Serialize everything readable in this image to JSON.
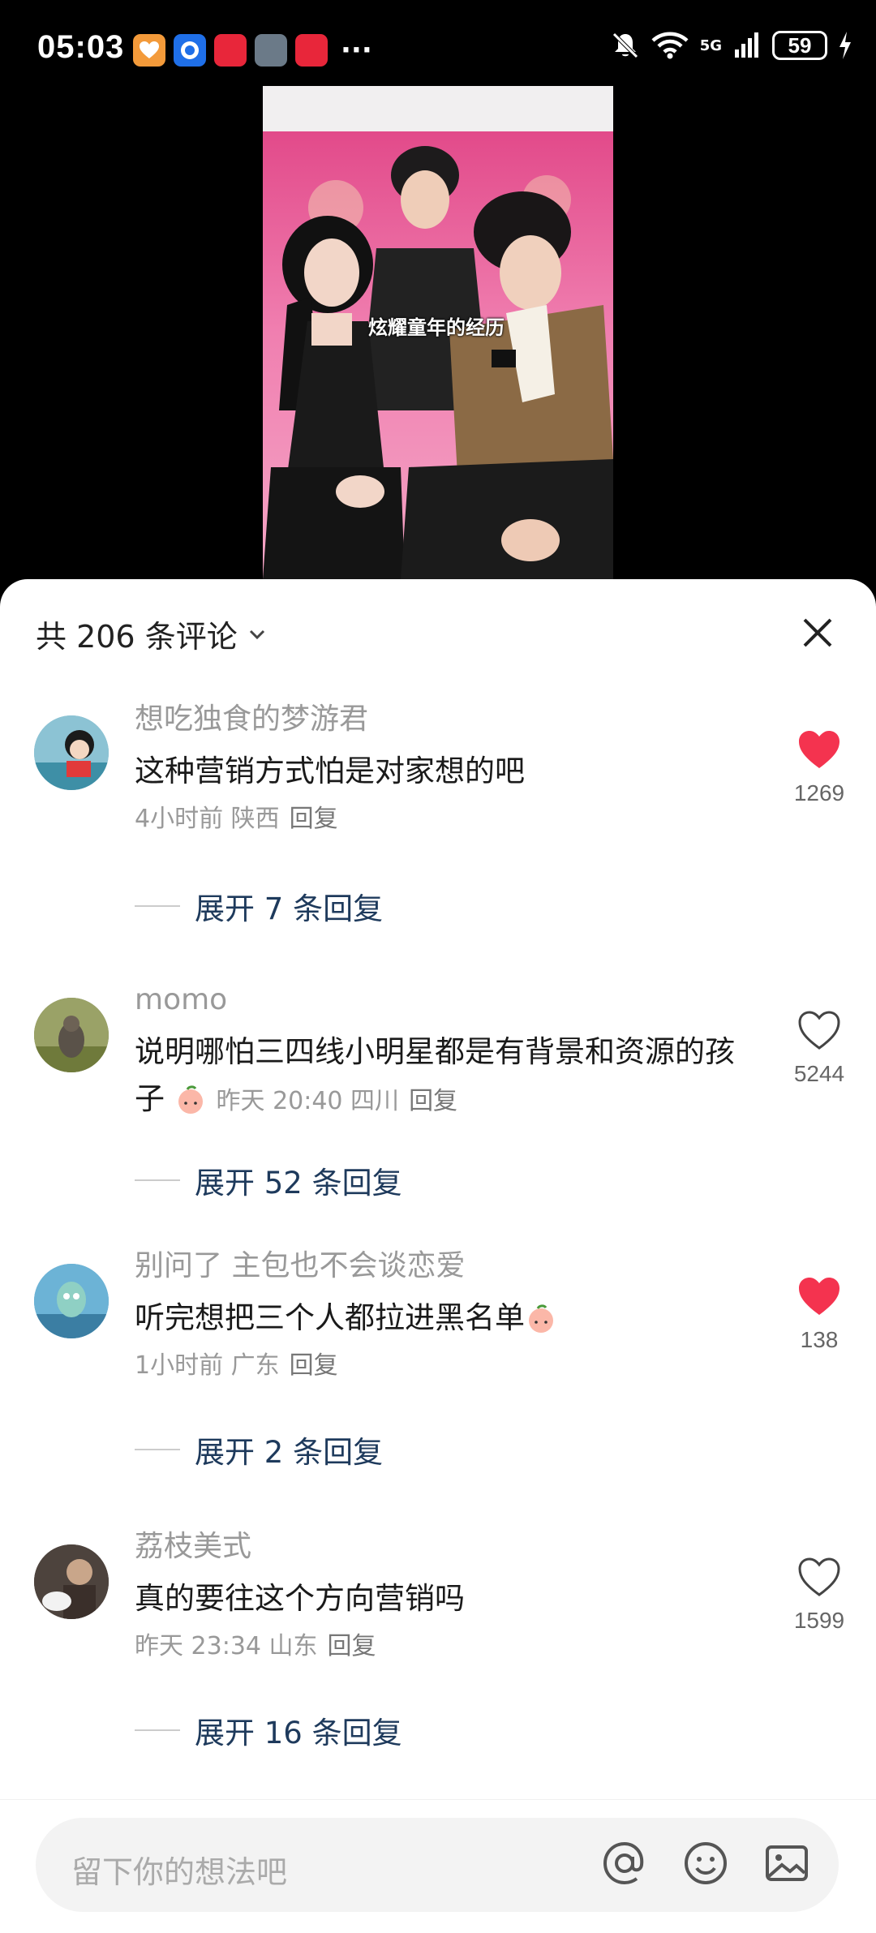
{
  "status_bar": {
    "time": "05:03",
    "battery": "59",
    "network": "5G"
  },
  "video": {
    "caption": "炫耀童年的经历"
  },
  "comments_header": {
    "title": "共 206 条评论"
  },
  "comments": [
    {
      "username": "想吃独食的梦游君",
      "text": "这种营销方式怕是对家想的吧",
      "meta": "4小时前 陕西",
      "reply_label": "回复",
      "likes": "1269",
      "liked": true,
      "expand_label": "展开 7 条回复"
    },
    {
      "username": "momo",
      "text": "说明哪怕三四线小明星都是有背景和资源的孩子",
      "meta": "昨天 20:40 四川",
      "reply_label": "回复",
      "likes": "5244",
      "liked": false,
      "expand_label": "展开 52 条回复"
    },
    {
      "username": "别问了 主包也不会谈恋爱",
      "text": "听完想把三个人都拉进黑名单",
      "meta": "1小时前 广东",
      "reply_label": "回复",
      "likes": "138",
      "liked": true,
      "expand_label": "展开 2 条回复"
    },
    {
      "username": "荔枝美式",
      "text": "真的要往这个方向营销吗",
      "meta": "昨天 23:34 山东",
      "reply_label": "回复",
      "likes": "1599",
      "liked": false,
      "expand_label": "展开 16 条回复"
    }
  ],
  "input": {
    "placeholder": "留下你的想法吧"
  },
  "colors": {
    "liked": "#f4334f",
    "link": "#1e3a5c",
    "muted": "#999999"
  }
}
